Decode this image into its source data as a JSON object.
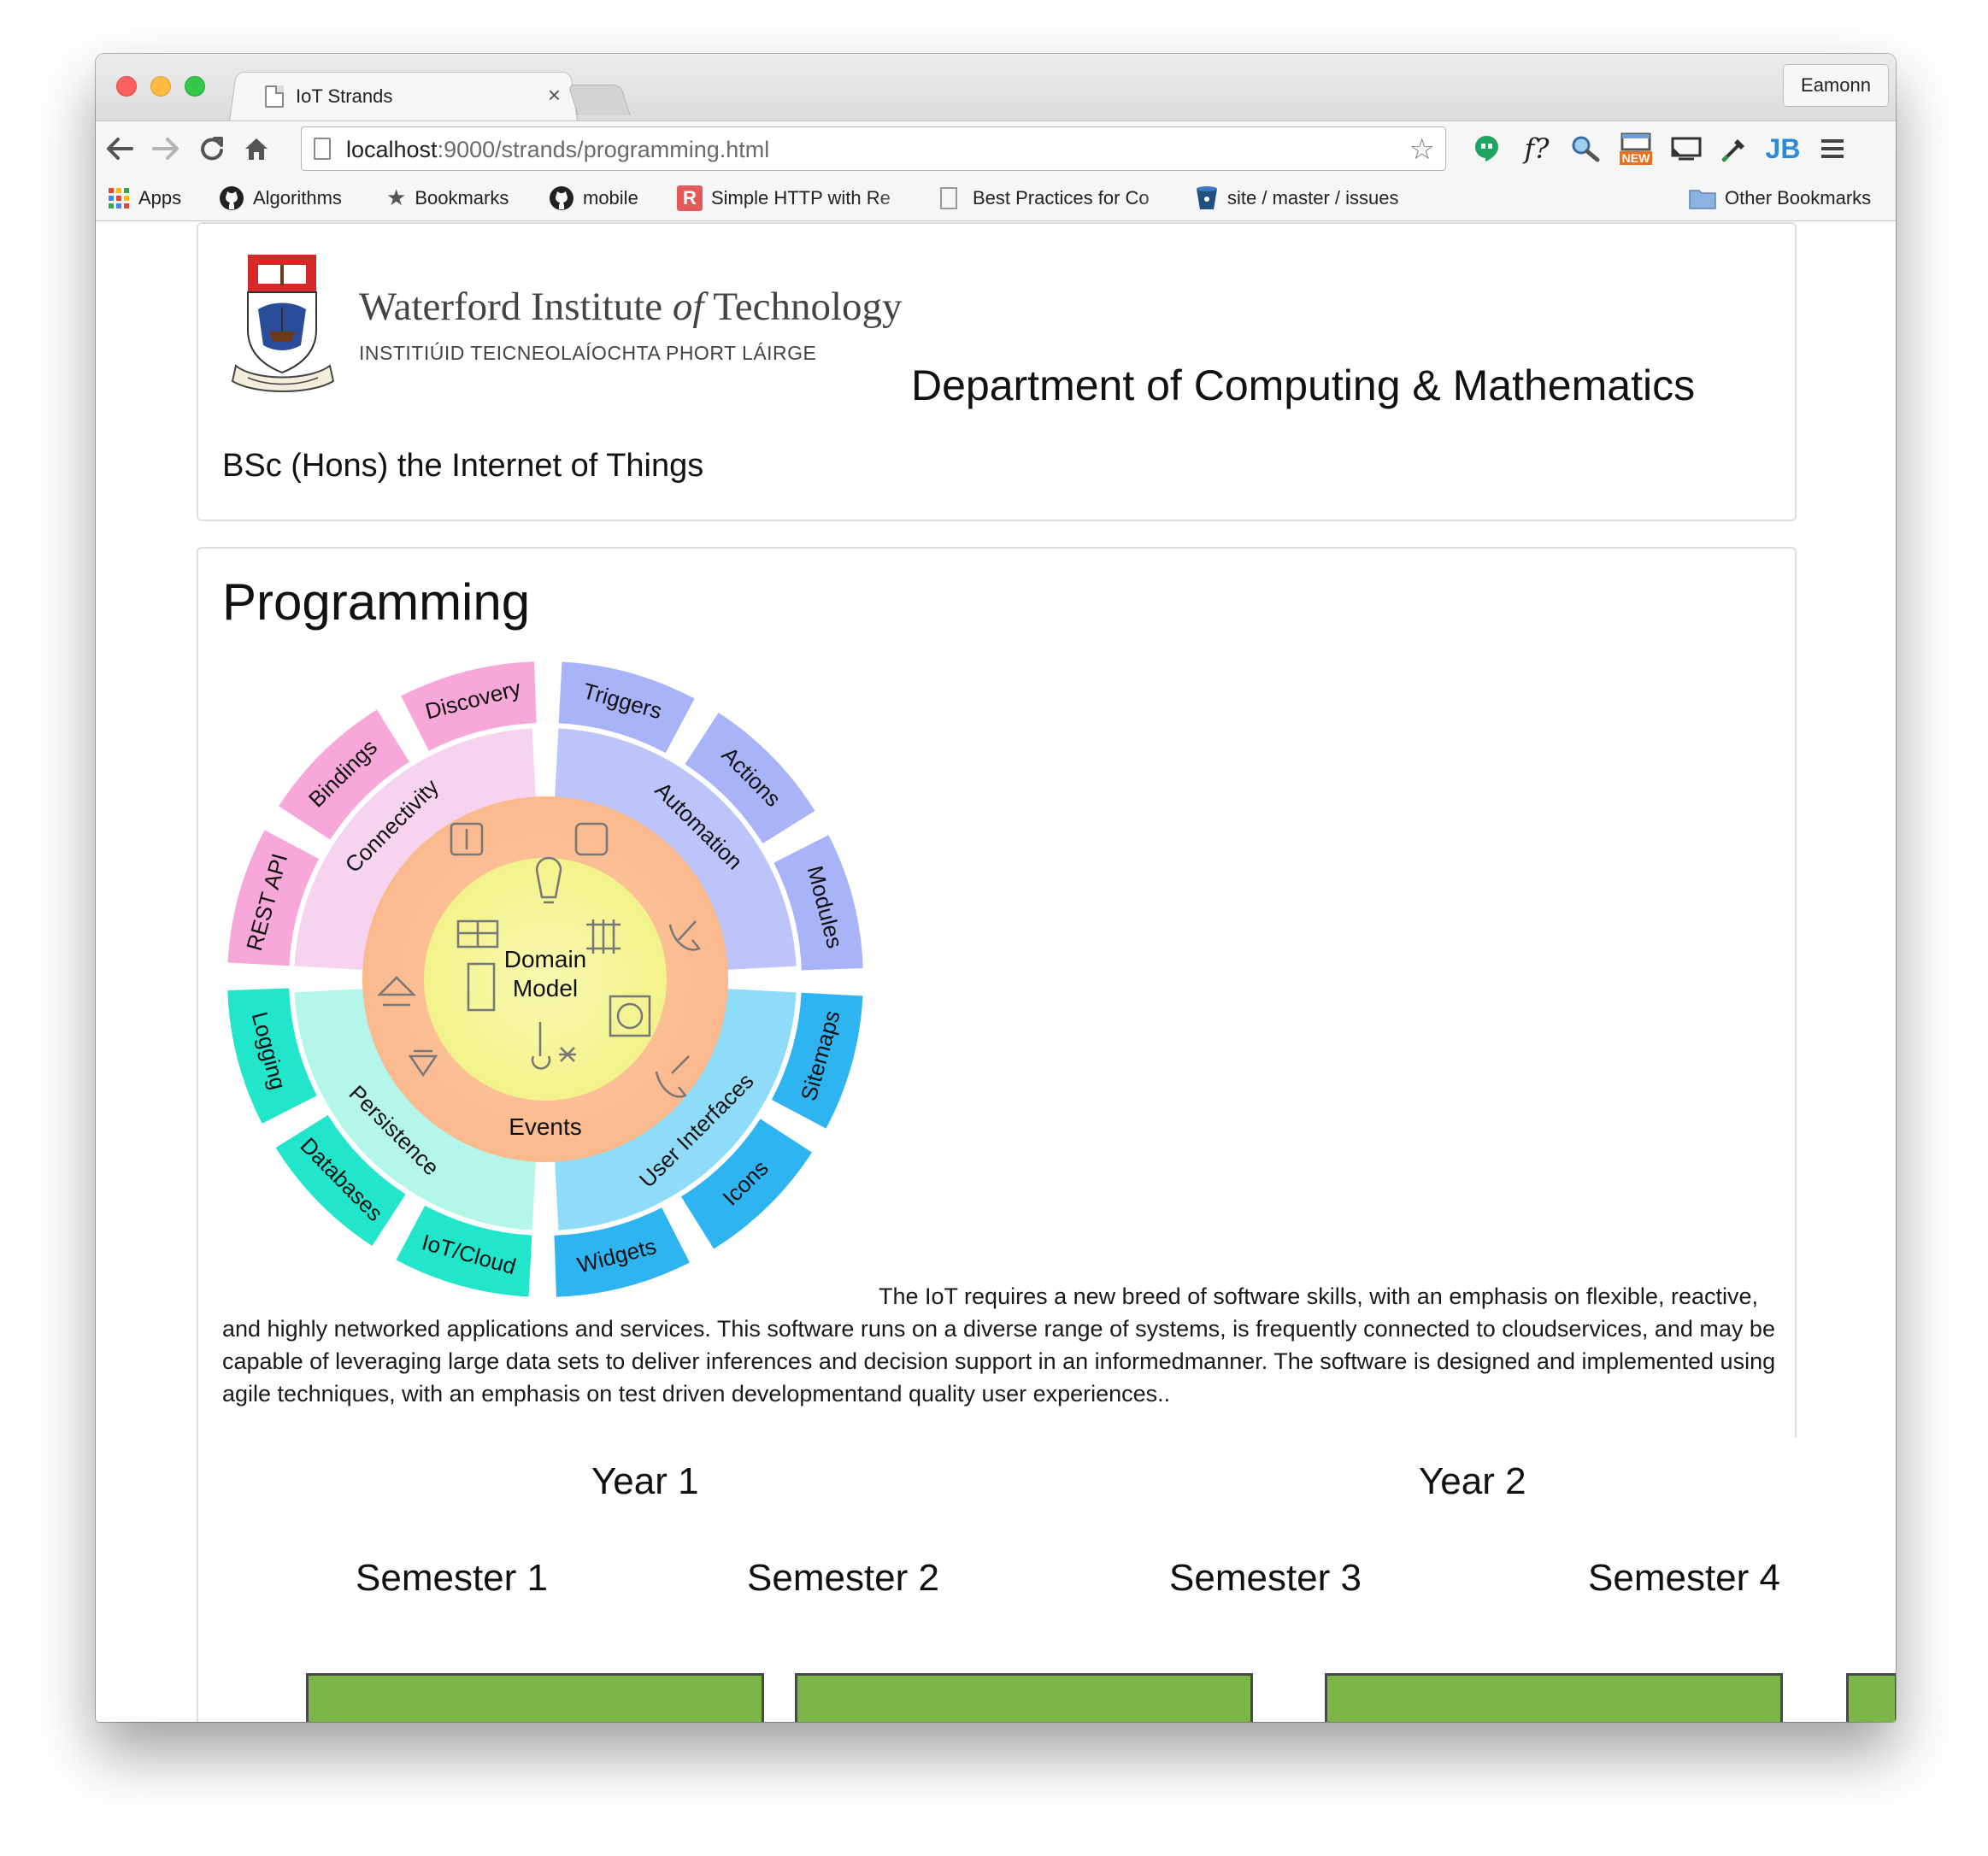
{
  "browser": {
    "tab_title": "IoT Strands",
    "profile": "Eamonn",
    "url_host": "localhost",
    "url_rest": ":9000/strands/programming.html",
    "ext_new_badge": "NEW",
    "ext_fquestion": "f?",
    "ext_jb": "JB"
  },
  "bookmarks": {
    "apps": "Apps",
    "algorithms": "Algorithms",
    "bookmarks": "Bookmarks",
    "mobile": "mobile",
    "simple_http": "Simple HTTP with Re",
    "simple_http_icon": "R",
    "best_practices": "Best Practices for Co",
    "site_issues": "site / master / issues",
    "other": "Other Bookmarks"
  },
  "header": {
    "institute_name": "Waterford Institute of Technology",
    "institute_name_pre": "Waterford Institute ",
    "institute_name_of": "of",
    "institute_name_post": " Technology",
    "institute_irish": "INSTITIÚID TEICNEOLAÍOCHTA PHORT LÁIRGE",
    "department": "Department of Computing & Mathematics",
    "degree": "BSc (Hons) the Internet of Things"
  },
  "strand": {
    "title": "Programming",
    "description": "The IoT requires a new breed of software skills, with an emphasis on flexible, reactive, and highly networked applications and services. This software runs on a diverse range of systems, is frequently connected to cloudservices, and may be capable of leveraging large data sets to deliver inferences and decision support in an informedmanner. The software is designed and implemented using agile techniques, with an emphasis on test driven developmentand quality user experiences.."
  },
  "wheel": {
    "center_line1": "Domain",
    "center_line2": "Model",
    "events": "Events",
    "inner": [
      "Connectivity",
      "Automation",
      "User Interfaces",
      "Persistence"
    ],
    "outer": [
      "REST API",
      "Bindings",
      "Discovery",
      "Triggers",
      "Actions",
      "Modules",
      "Sitemaps",
      "Icons",
      "Widgets",
      "IoT/Cloud",
      "Databases",
      "Logging"
    ],
    "colors": {
      "pink_outer": "#f7a8d8",
      "pink_inner": "#f6d4f0",
      "blue_outer": "#a9b3f7",
      "blue_inner": "#bcc4fa",
      "cyan_outer": "#2fb4f2",
      "cyan_inner": "#8fdcf8",
      "teal_outer": "#22e6cc",
      "teal_inner": "#b4f6ea",
      "orange_ring": "#fbb98e",
      "yellow_core": "#f2f38a"
    }
  },
  "curriculum": {
    "years": [
      "Year 1",
      "Year 2"
    ],
    "semesters": [
      "Semester 1",
      "Semester 2",
      "Semester 3",
      "Semester 4"
    ],
    "module_color": "#7ab648"
  }
}
